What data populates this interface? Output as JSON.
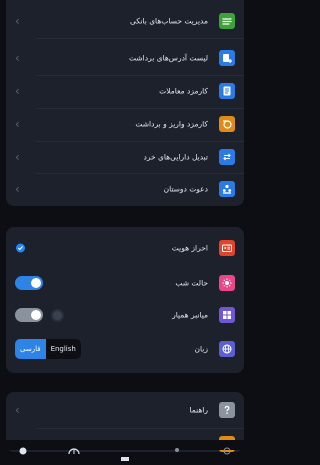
{
  "menu": {
    "items": [
      {
        "label": "مدیریت حساب‌های بانکی",
        "icon": "bank-cards-icon",
        "color": "#3fa13a"
      },
      {
        "label": "لیست آدرس‌های برداشت",
        "icon": "address-list-icon",
        "color": "#2a7be4"
      },
      {
        "label": "کارمزد معاملات",
        "icon": "document-icon",
        "color": "#2a7be4"
      },
      {
        "label": "کارمزد واریز و برداشت",
        "icon": "coins-icon",
        "color": "#e08a17"
      },
      {
        "label": "تبدیل دارایی‌های خرد",
        "icon": "exchange-icon",
        "color": "#2a7be4"
      },
      {
        "label": "دعوت دوستان",
        "icon": "people-icon",
        "color": "#2a7be4"
      }
    ]
  },
  "settings": {
    "verification": {
      "label": "احراز هویت",
      "icon": "id-card-icon",
      "color": "#e0442c"
    },
    "night_mode": {
      "label": "حالت شب",
      "icon": "sun-icon",
      "color": "#e8478a",
      "enabled": true
    },
    "shortcuts": {
      "label": "میانبر همیار",
      "icon": "grid-icon",
      "color": "#7057d6",
      "enabled": true
    },
    "language": {
      "label": "زبان",
      "icon": "globe-icon",
      "color": "#5b5fd1",
      "options": [
        "فارسی",
        "English"
      ],
      "selected": "فارسی"
    }
  },
  "help": {
    "label": "راهنما",
    "icon": "question-icon",
    "color": "#8c939c"
  },
  "bottom_nav": {
    "icons": [
      "gear-icon",
      "chart-pie-icon",
      "home-icon",
      "people-icon",
      "wallet-icon"
    ]
  }
}
